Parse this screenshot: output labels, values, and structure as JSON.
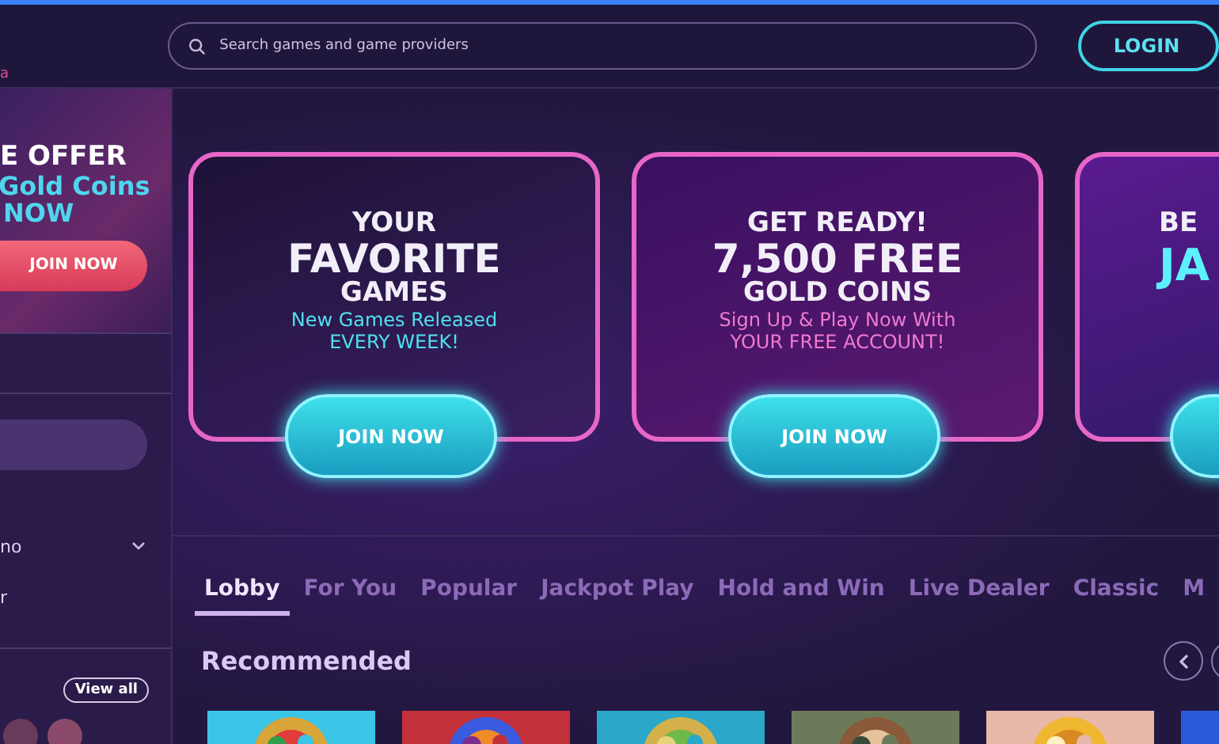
{
  "header": {
    "brand_fragment": "a",
    "search": {
      "placeholder": "Search games and game providers"
    },
    "login": "LOGIN"
  },
  "sidebar": {
    "promo": {
      "lines": [
        "E OFFER",
        "Gold Coins",
        "NOW"
      ],
      "button": "JOIN NOW"
    },
    "items": [
      {
        "label": "no",
        "expandable": true
      },
      {
        "label": "r",
        "expandable": false
      }
    ],
    "view_all": "View all"
  },
  "banners": [
    {
      "heading": [
        "YOUR",
        "FAVORITE",
        "GAMES"
      ],
      "sub": [
        "New Games Released",
        "EVERY WEEK!"
      ],
      "button": "JOIN NOW"
    },
    {
      "heading": [
        "GET READY!",
        "7,500 FREE",
        "GOLD COINS"
      ],
      "sub": [
        "Sign Up & Play Now With",
        "YOUR FREE ACCOUNT!"
      ],
      "button": "JOIN NOW"
    },
    {
      "heading": [
        "BE"
      ],
      "sub": [
        "JA"
      ]
    }
  ],
  "tabs": [
    {
      "label": "Lobby",
      "selected": true
    },
    {
      "label": "For You",
      "selected": false
    },
    {
      "label": "Popular",
      "selected": false
    },
    {
      "label": "Jackpot Play",
      "selected": false
    },
    {
      "label": "Hold and Win",
      "selected": false
    },
    {
      "label": "Live Dealer",
      "selected": false
    },
    {
      "label": "Classic",
      "selected": false
    },
    {
      "label": "M",
      "selected": false
    }
  ],
  "section_title": "Recommended"
}
